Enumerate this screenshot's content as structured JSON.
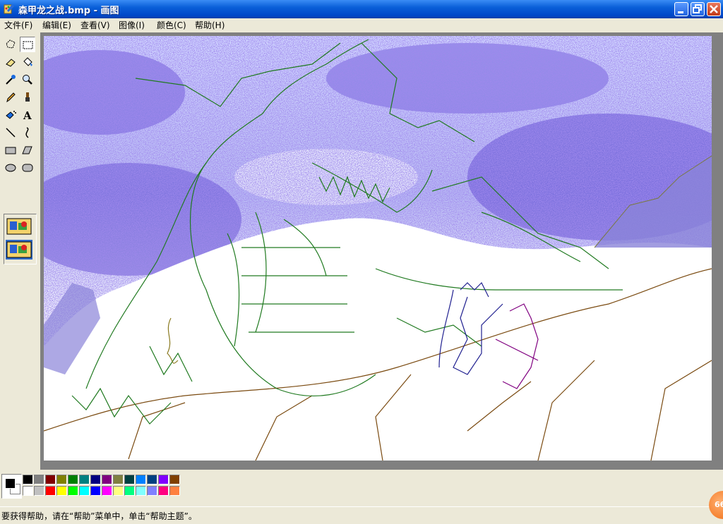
{
  "window": {
    "title": "森甲龙之战.bmp - 画图",
    "icon": "paint-brush-icon"
  },
  "menu": [
    {
      "label": "文件(F)"
    },
    {
      "label": "编辑(E)"
    },
    {
      "label": "查看(V)"
    },
    {
      "label": "图像(I)"
    },
    {
      "label": "颜色(C)"
    },
    {
      "label": "帮助(H)"
    }
  ],
  "tools": [
    "free-select-icon",
    "rect-select-icon",
    "eraser-icon",
    "fill-bucket-icon",
    "eyedropper-icon",
    "magnifier-icon",
    "pencil-icon",
    "brush-icon",
    "airbrush-icon",
    "text-icon",
    "line-icon",
    "curve-icon",
    "rectangle-icon",
    "polygon-icon",
    "ellipse-icon",
    "rounded-rect-icon"
  ],
  "palette": {
    "foreground": "#000000",
    "background": "#ffffff",
    "colors_top": [
      "#000000",
      "#808080",
      "#800000",
      "#808000",
      "#008000",
      "#008080",
      "#000080",
      "#800080",
      "#808040",
      "#004040",
      "#0080ff",
      "#004080",
      "#8000ff",
      "#804000"
    ],
    "colors_bottom": [
      "#ffffff",
      "#c0c0c0",
      "#ff0000",
      "#ffff00",
      "#00ff00",
      "#00ffff",
      "#0000ff",
      "#ff00ff",
      "#ffff80",
      "#00ff80",
      "#80ffff",
      "#8080ff",
      "#ff0080",
      "#ff8040"
    ]
  },
  "status": {
    "text": "要获得帮助，请在“帮助”菜单中，单击“帮助主题”。"
  },
  "tray": {
    "badge": "66"
  }
}
